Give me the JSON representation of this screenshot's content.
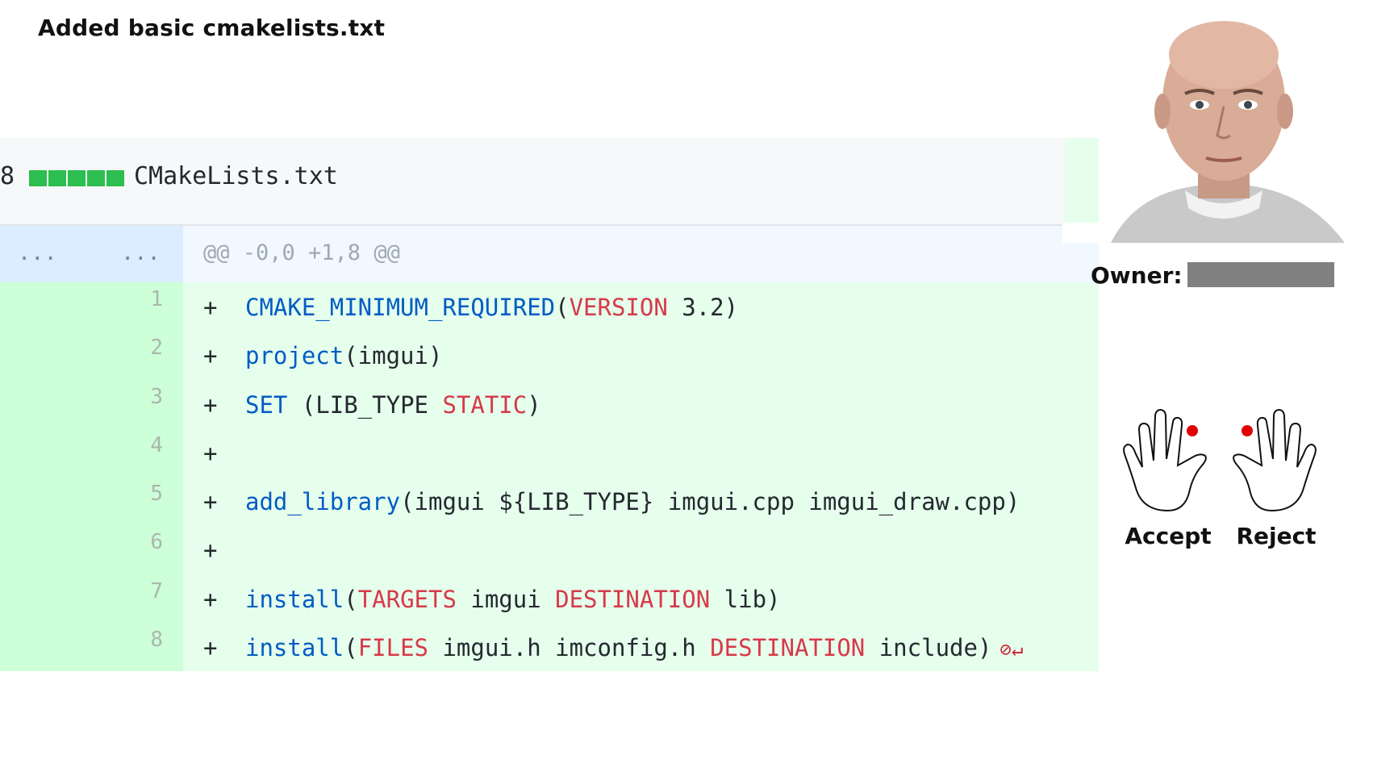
{
  "commit": {
    "title": "Added basic cmakelists.txt"
  },
  "file": {
    "changes": "8",
    "name": "CMakeLists.txt"
  },
  "hunk": {
    "old_dots": "...",
    "new_dots": "...",
    "header": "@@ -0,0 +1,8 @@"
  },
  "lines": [
    {
      "num": "1",
      "sign": "+",
      "tokens": [
        {
          "t": "CMAKE_MINIMUM_REQUIRED",
          "s": "k"
        },
        {
          "t": "(",
          "s": ""
        },
        {
          "t": "VERSION",
          "s": "c"
        },
        {
          "t": " 3.2)",
          "s": ""
        }
      ]
    },
    {
      "num": "2",
      "sign": "+",
      "tokens": [
        {
          "t": "project",
          "s": "k"
        },
        {
          "t": "(imgui)",
          "s": ""
        }
      ]
    },
    {
      "num": "3",
      "sign": "+",
      "tokens": [
        {
          "t": "SET",
          "s": "k"
        },
        {
          "t": " (LIB_TYPE ",
          "s": ""
        },
        {
          "t": "STATIC",
          "s": "c"
        },
        {
          "t": ")",
          "s": ""
        }
      ]
    },
    {
      "num": "4",
      "sign": "+",
      "tokens": []
    },
    {
      "num": "5",
      "sign": "+",
      "tokens": [
        {
          "t": "add_library",
          "s": "k"
        },
        {
          "t": "(imgui ${LIB_TYPE} imgui.cpp imgui_draw.cpp)",
          "s": ""
        }
      ]
    },
    {
      "num": "6",
      "sign": "+",
      "tokens": []
    },
    {
      "num": "7",
      "sign": "+",
      "tokens": [
        {
          "t": "install",
          "s": "k"
        },
        {
          "t": "(",
          "s": ""
        },
        {
          "t": "TARGETS",
          "s": "c"
        },
        {
          "t": " imgui ",
          "s": ""
        },
        {
          "t": "DESTINATION",
          "s": "c"
        },
        {
          "t": " lib)",
          "s": ""
        }
      ]
    },
    {
      "num": "8",
      "sign": "+",
      "tokens": [
        {
          "t": "install",
          "s": "k"
        },
        {
          "t": "(",
          "s": ""
        },
        {
          "t": "FILES",
          "s": "c"
        },
        {
          "t": " imgui.h imconfig.h ",
          "s": ""
        },
        {
          "t": "DESTINATION",
          "s": "c"
        },
        {
          "t": " include)",
          "s": ""
        }
      ],
      "no_newline_icon": "no-newline-at-end-icon"
    }
  ],
  "owner": {
    "label": "Owner:"
  },
  "gestures": [
    {
      "label": "Accept",
      "icon": "hand-accept-icon"
    },
    {
      "label": "Reject",
      "icon": "hand-reject-icon"
    }
  ],
  "colors": {
    "added_bg": "#e6ffed",
    "added_gutter": "#cdffd8",
    "hunk_bg": "#f1f8ff",
    "keyword": "#005cc5",
    "constant": "#d73a49",
    "diffstat": "#2cbe4e",
    "marker": "#e00000"
  }
}
